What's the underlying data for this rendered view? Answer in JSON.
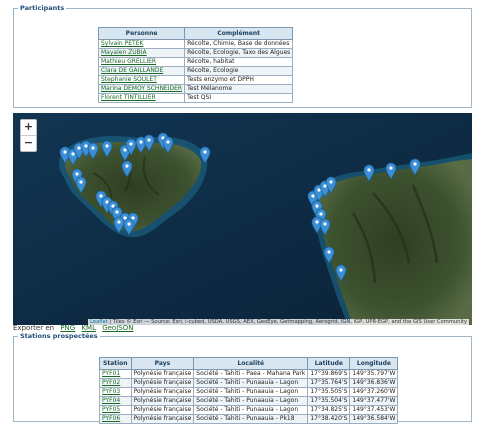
{
  "participants": {
    "legend": "Participants",
    "headers": [
      "Personne",
      "Complément"
    ],
    "rows": [
      {
        "name": "Sylvain PETEK",
        "role": "Récolte, Chimie, Base de données"
      },
      {
        "name": "Mayalen ZUBIA",
        "role": "Récolte, Ecologie, Taxo des Algues"
      },
      {
        "name": "Mathieu GRELLIER",
        "role": "Récolte, habitat"
      },
      {
        "name": "Clara DE GAILLANDE",
        "role": "Récolte, Ecologie"
      },
      {
        "name": "Stephanie SOULET",
        "role": "Tests enzymo et DPPH"
      },
      {
        "name": "Marina DEMOY SCHNEIDER",
        "role": "Test Mélanome"
      },
      {
        "name": "Florent TINTILLIER",
        "role": "Test QSI"
      }
    ]
  },
  "map": {
    "zoom_in": "+",
    "zoom_out": "−",
    "attribution_link": "Leaflet",
    "attribution_text": " | Tiles © Esri — Source: Esri, i-cubed, USDA, USGS, AEX, GeoEye, Getmapping, Aerogrid, IGN, IGP, UPR-EGP, and the GIS User Community",
    "marker_icon": "map-marker-icon",
    "marker_color": "#3a8fd6"
  },
  "export": {
    "label": "Exporter en",
    "links": [
      "PNG",
      "KML",
      "GeoJSON"
    ]
  },
  "stations": {
    "legend": "Stations prospectées",
    "headers": [
      "Station",
      "Pays",
      "Localité",
      "Latitude",
      "Longitude"
    ],
    "rows": [
      {
        "station": "PYF01",
        "pays": "Polynésie française",
        "localite": "Société - Tahiti - Paea - Mahana Park",
        "lat": "17°39.869'S",
        "lon": "149°35.797'W"
      },
      {
        "station": "PYF02",
        "pays": "Polynésie française",
        "localite": "Société - Tahiti - Punaauia - Lagon",
        "lat": "17°35.764'S",
        "lon": "149°36.836'W"
      },
      {
        "station": "PYF03",
        "pays": "Polynésie française",
        "localite": "Société - Tahiti - Punaauia - Lagon",
        "lat": "17°35.505'S",
        "lon": "149°37.260'W"
      },
      {
        "station": "PYF04",
        "pays": "Polynésie française",
        "localite": "Société - Tahiti - Punaauia - Lagon",
        "lat": "17°35.504'S",
        "lon": "149°37.477'W"
      },
      {
        "station": "PYF05",
        "pays": "Polynésie française",
        "localite": "Société - Tahiti - Punaauia - Lagon",
        "lat": "17°34.825'S",
        "lon": "149°37.453'W"
      },
      {
        "station": "PYF06",
        "pays": "Polynésie française",
        "localite": "Société - Tahiti - Punaauia - Pk18",
        "lat": "17°38.420'S",
        "lon": "149°36.584'W"
      }
    ]
  }
}
